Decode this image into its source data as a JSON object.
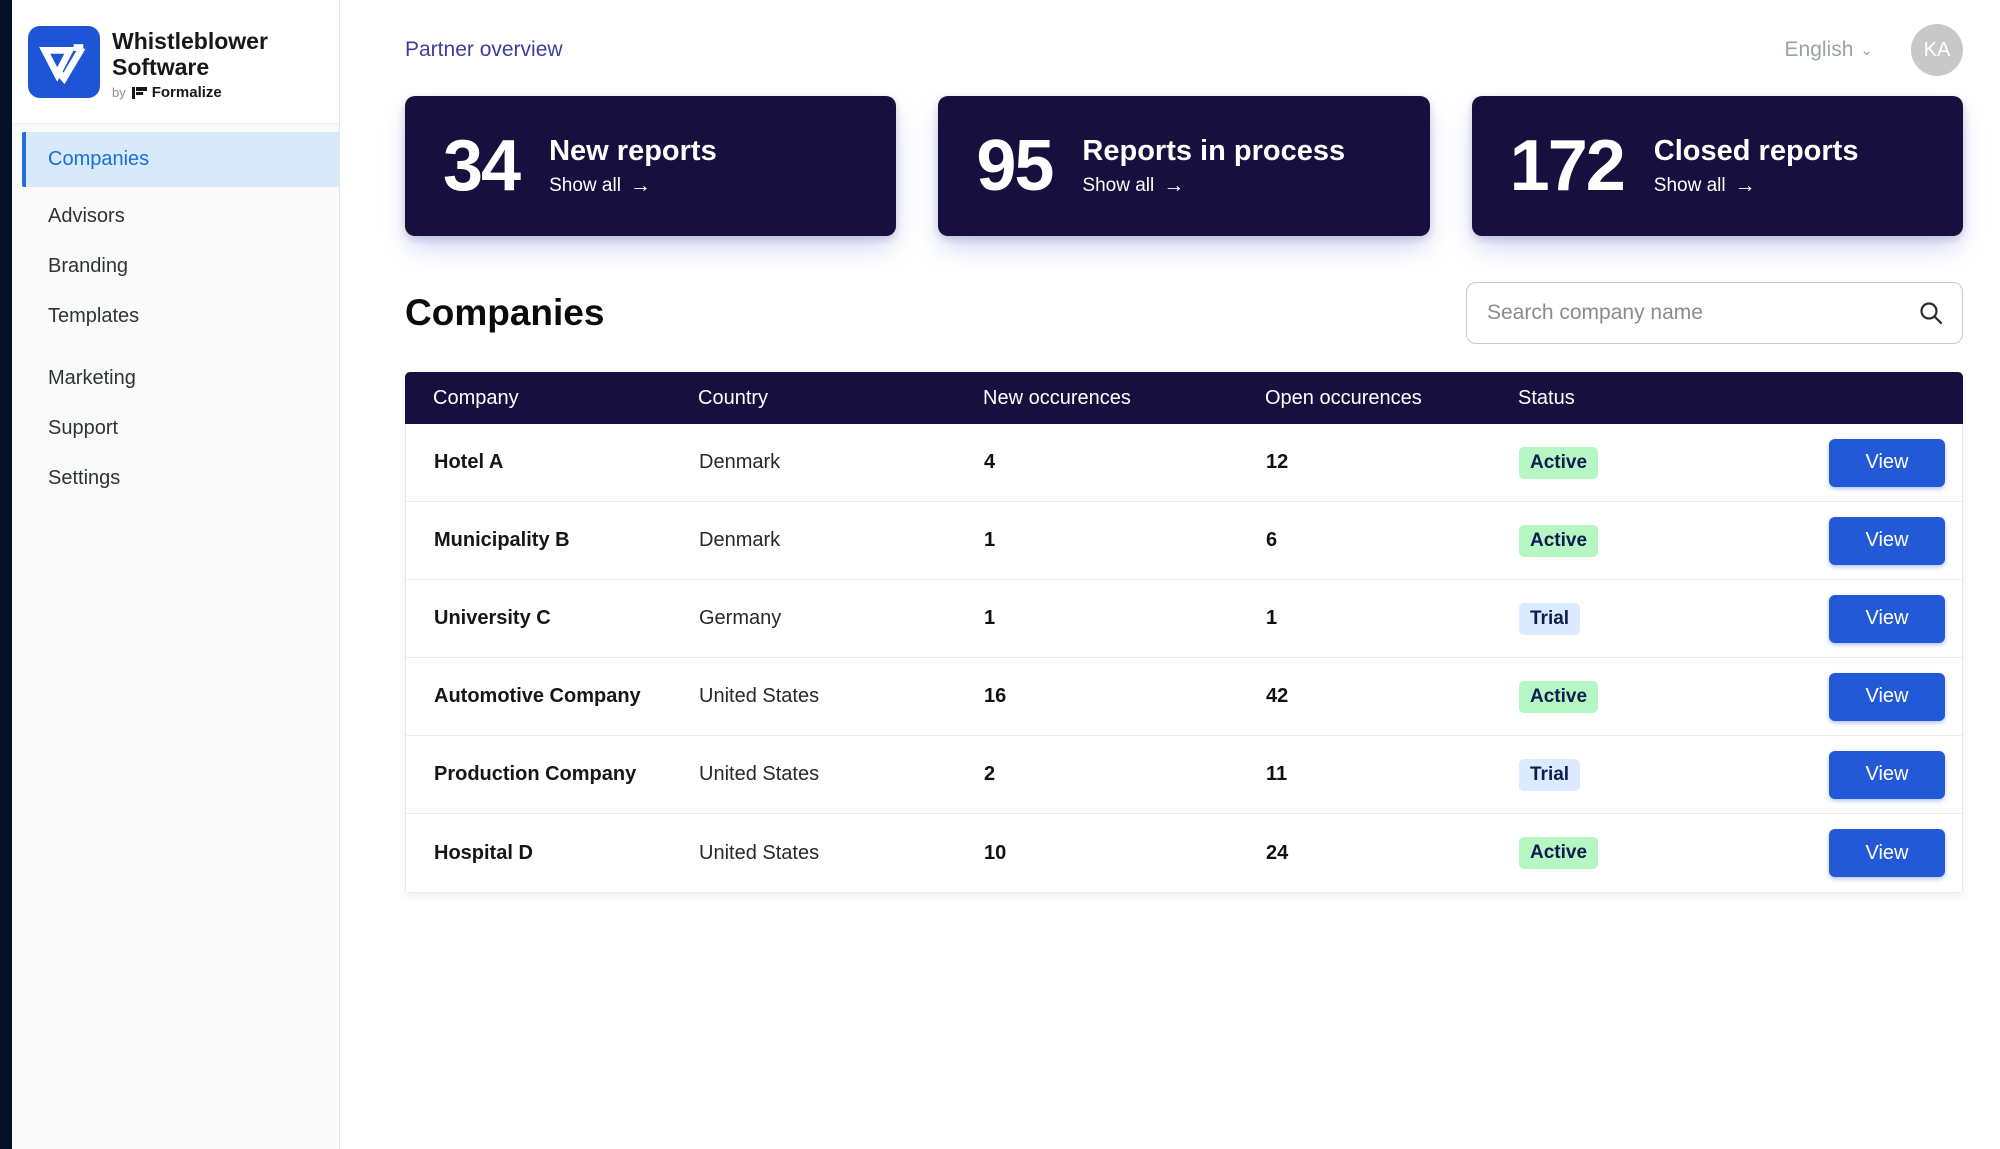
{
  "sidebar": {
    "logo": {
      "title_line1": "Whistleblower",
      "title_line2": "Software",
      "by": "by",
      "brand": "Formalize"
    },
    "items": [
      {
        "label": "Companies",
        "active": true
      },
      {
        "label": "Advisors"
      },
      {
        "label": "Branding"
      },
      {
        "label": "Templates"
      },
      {
        "label": "Marketing"
      },
      {
        "label": "Support"
      },
      {
        "label": "Settings"
      }
    ]
  },
  "header": {
    "breadcrumb": "Partner overview",
    "language": "English",
    "avatar_initials": "KA"
  },
  "stats": [
    {
      "value": "34",
      "label": "New reports",
      "link": "Show all"
    },
    {
      "value": "95",
      "label": "Reports in process",
      "link": "Show all"
    },
    {
      "value": "172",
      "label": "Closed reports",
      "link": "Show all"
    }
  ],
  "companies": {
    "title": "Companies",
    "search_placeholder": "Search company name",
    "table": {
      "columns": [
        "Company",
        "Country",
        "New occurences",
        "Open occurences",
        "Status"
      ],
      "view_label": "View",
      "rows": [
        {
          "company": "Hotel A",
          "country": "Denmark",
          "new": "4",
          "open": "12",
          "status": "Active"
        },
        {
          "company": "Municipality B",
          "country": "Denmark",
          "new": "1",
          "open": "6",
          "status": "Active"
        },
        {
          "company": "University C",
          "country": "Germany",
          "new": "1",
          "open": "1",
          "status": "Trial"
        },
        {
          "company": "Automotive Company",
          "country": "United States",
          "new": "16",
          "open": "42",
          "status": "Active"
        },
        {
          "company": "Production Company",
          "country": "United States",
          "new": "2",
          "open": "11",
          "status": "Trial"
        },
        {
          "company": "Hospital D",
          "country": "United States",
          "new": "10",
          "open": "24",
          "status": "Active"
        }
      ]
    }
  },
  "colors": {
    "brand_blue": "#1d55d6",
    "dark_navy": "#170f3e",
    "active_nav_blue": "#1a6fd8",
    "status_active_bg": "#b6f6c2",
    "status_trial_bg": "#dbeafe",
    "status_text": "#0e1c4f",
    "view_button_blue": "#2159d6",
    "breadcrumb_indigo": "#3d3d9c"
  }
}
